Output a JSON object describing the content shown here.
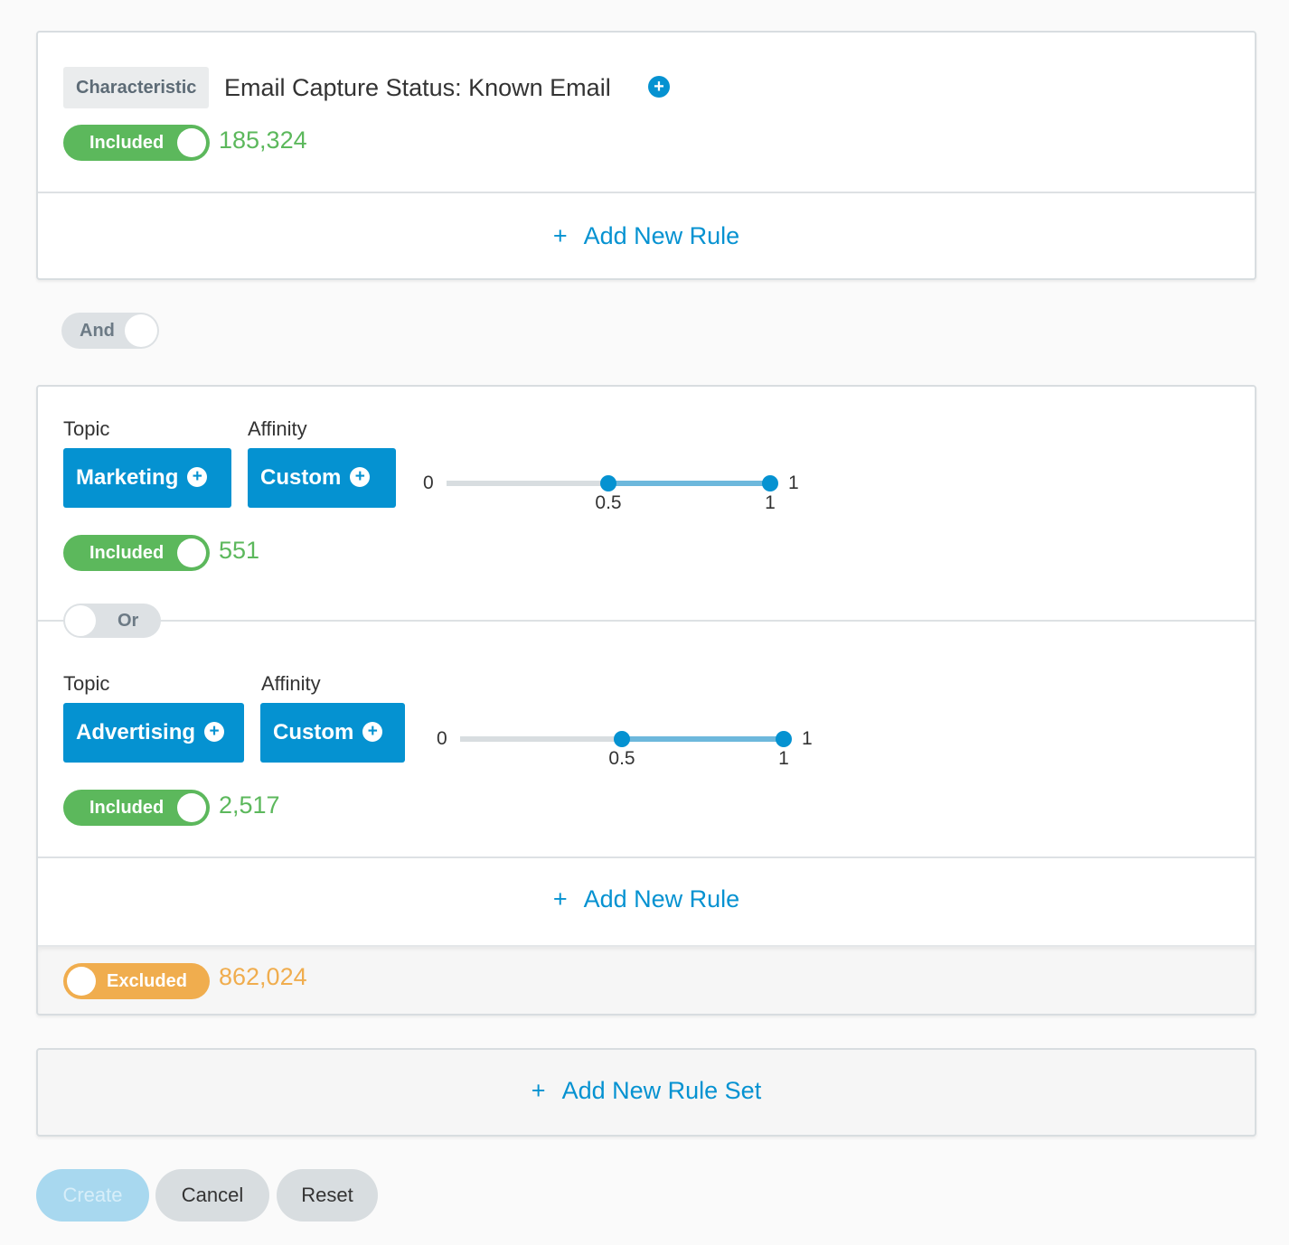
{
  "rule_set_1": {
    "rule": {
      "chip_label": "Characteristic",
      "title": "Email Capture Status: Known Email",
      "add_icon": "plus-circle-icon",
      "toggle_label": "Included",
      "count": "185,324"
    },
    "add_rule_label": "Add New Rule",
    "add_rule_icon": "+"
  },
  "logic_between_sets": {
    "label": "And"
  },
  "rule_set_2": {
    "rules": [
      {
        "topic_label": "Topic",
        "topic_value": "Marketing",
        "affinity_label": "Affinity",
        "affinity_value": "Custom",
        "slider": {
          "min": "0",
          "max": "1",
          "low": 0.5,
          "high": 1,
          "low_label": "0.5",
          "high_label": "1"
        },
        "toggle_label": "Included",
        "count": "551"
      },
      {
        "topic_label": "Topic",
        "topic_value": "Advertising",
        "affinity_label": "Affinity",
        "affinity_value": "Custom",
        "slider": {
          "min": "0",
          "max": "1",
          "low": 0.5,
          "high": 1,
          "low_label": "0.5",
          "high_label": "1"
        },
        "toggle_label": "Included",
        "count": "2,517"
      }
    ],
    "logic_between_rules": {
      "label": "Or"
    },
    "add_rule_label": "Add New Rule",
    "add_rule_icon": "+",
    "set_toggle_label": "Excluded",
    "set_count": "862,024"
  },
  "add_rule_set": {
    "icon": "+",
    "label": "Add New Rule Set"
  },
  "actions": {
    "create": "Create",
    "cancel": "Cancel",
    "reset": "Reset"
  },
  "colors": {
    "accent": "#0592d1",
    "included": "#5cb85c",
    "excluded": "#f0ad4e",
    "neutral": "#d8dde0"
  }
}
